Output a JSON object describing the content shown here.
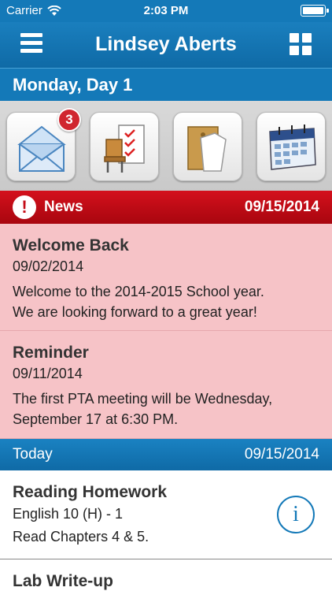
{
  "status_bar": {
    "carrier": "Carrier",
    "time": "2:03 PM"
  },
  "header": {
    "title": "Lindsey Aberts"
  },
  "day_bar": {
    "label": "Monday, Day 1"
  },
  "quick_tiles": [
    {
      "icon": "mail-icon",
      "badge": "3"
    },
    {
      "icon": "attendance-icon"
    },
    {
      "icon": "folder-icon"
    },
    {
      "icon": "calendar-icon"
    }
  ],
  "news": {
    "label": "News",
    "date": "09/15/2014",
    "items": [
      {
        "title": "Welcome Back",
        "date": "09/02/2014",
        "line1": "Welcome to the 2014-2015 School year.",
        "line2": "We are looking forward to a great year!"
      },
      {
        "title": "Reminder",
        "date": "09/11/2014",
        "line1": "The first PTA meeting will be Wednesday,",
        "line2": "September 17 at 6:30 PM."
      }
    ]
  },
  "today": {
    "label": "Today",
    "date": "09/15/2014",
    "items": [
      {
        "title": "Reading Homework",
        "course": "English 10 (H) - 1",
        "note": "Read Chapters 4 & 5.",
        "info_glyph": "i"
      },
      {
        "title": "Lab Write-up"
      }
    ]
  },
  "colors": {
    "primary_blue": "#1479b8",
    "news_red": "#c40c16",
    "news_bg": "#f6c3c7",
    "badge_red": "#d0262f"
  }
}
